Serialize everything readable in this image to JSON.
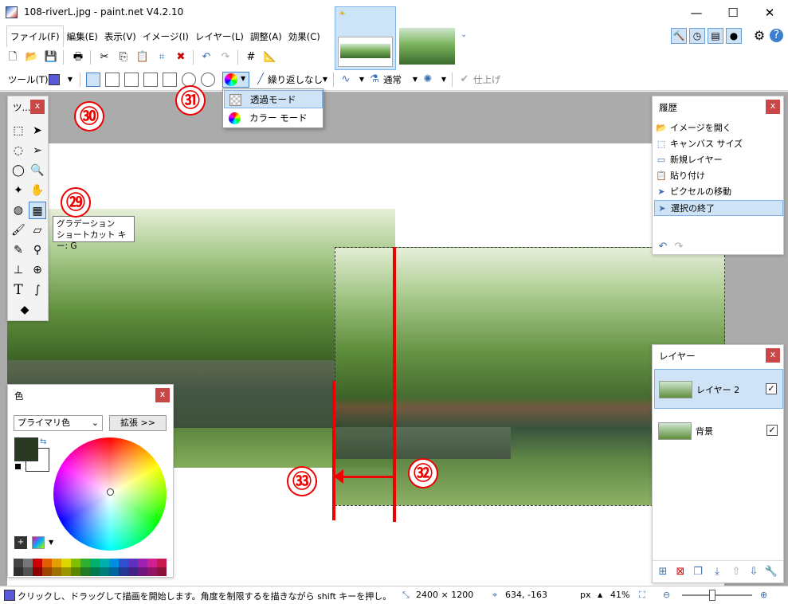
{
  "window": {
    "title": "108-riverL.jpg - paint.net V4.2.10",
    "minimize": "—",
    "maximize": "☐",
    "close": "✕"
  },
  "menu": [
    "ファイル(F)",
    "編集(E)",
    "表示(V)",
    "イメージ(I)",
    "レイヤー(L)",
    "調整(A)",
    "効果(C)"
  ],
  "toolbar": {
    "tool_label": "ツール(T):",
    "repeat_label": "繰り返しなし",
    "blend_label": "通常",
    "finish_label": "仕上げ"
  },
  "dropdown": {
    "items": [
      "透過モード",
      "カラー モード"
    ]
  },
  "tools_panel": {
    "title": "ツ...",
    "close": "x"
  },
  "tooltip": {
    "line1": "グラデーション",
    "line2": "ショートカット キー: G"
  },
  "history_panel": {
    "title": "履歴",
    "close": "x",
    "items": [
      "イメージを開く",
      "キャンバス サイズ",
      "新規レイヤー",
      "貼り付け",
      "ピクセルの移動",
      "選択の終了"
    ]
  },
  "layers_panel": {
    "title": "レイヤー",
    "close": "x",
    "layers": [
      "レイヤー 2",
      "背景"
    ]
  },
  "color_panel": {
    "title": "色",
    "close": "x",
    "select_value": "プライマリ色",
    "expand_label": "拡張 >>"
  },
  "annotations": [
    "㉚",
    "㉙",
    "㉛",
    "㉜",
    "㉝"
  ],
  "statusbar": {
    "hint": "クリックし、ドラッグして描画を開始します。角度を制限するを描きながら shift キーを押し。",
    "image_size": "2400 × 1200",
    "cursor_pos": "634, -163",
    "unit": "px",
    "zoom": "41%"
  },
  "colors": {
    "accent": "#3d7fcf",
    "selection_bg": "#cfe3f7",
    "annotation_red": "#e00000",
    "close_button": "#c84747",
    "workspace_bg": "#ababab"
  },
  "palette": [
    "#444444",
    "#777777",
    "#cc0000",
    "#e06000",
    "#e0a000",
    "#d8d800",
    "#80c000",
    "#30b030",
    "#00b070",
    "#00b0b0",
    "#0090e0",
    "#3050d0",
    "#6030c0",
    "#a020b0",
    "#d02090",
    "#c81850"
  ]
}
